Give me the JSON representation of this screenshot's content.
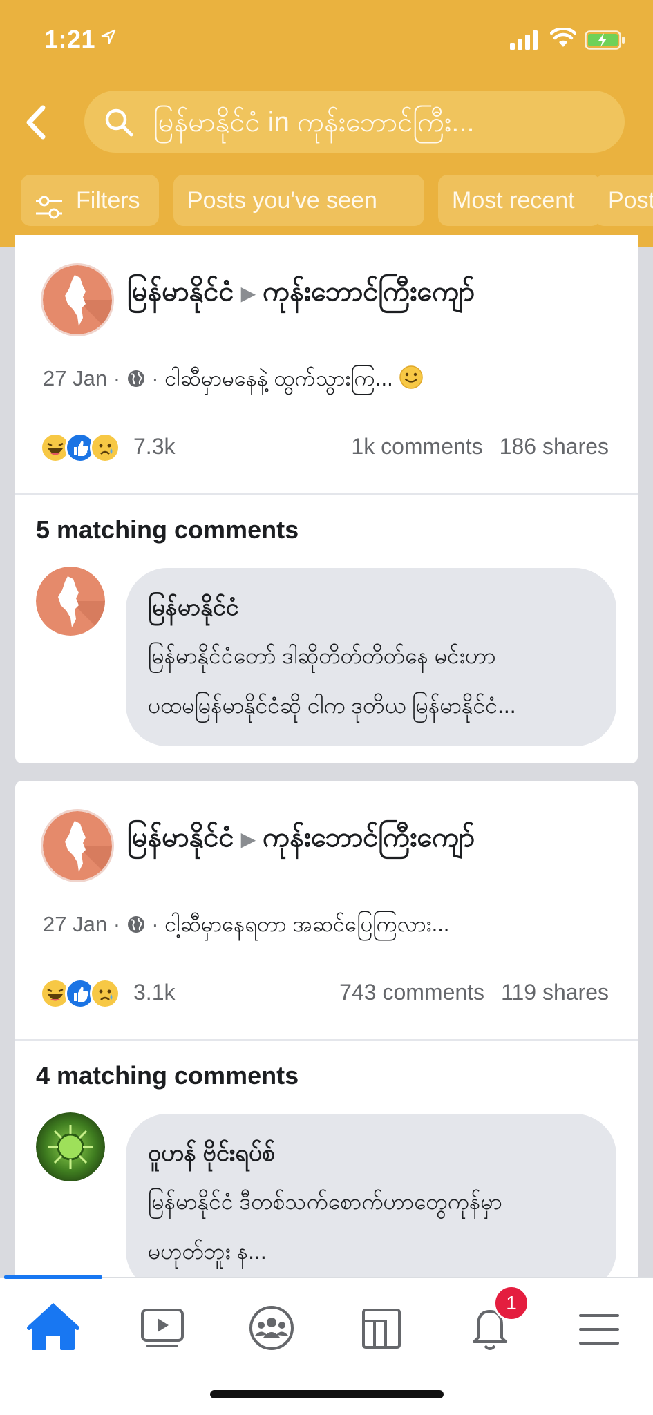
{
  "status_bar": {
    "time": "1:21"
  },
  "search": {
    "query": "မြန်မာနိုင်ငံ in ကုန်းဘောင်ကြီး..."
  },
  "filters": [
    {
      "label": "Filters"
    },
    {
      "label": "Posts you've seen"
    },
    {
      "label": "Most recent"
    },
    {
      "label": "Posts"
    }
  ],
  "posts": [
    {
      "page": "မြန်မာနိုင်ငံ",
      "group": "ကုန်းဘောင်ကြီးကျော်",
      "date": "27 Jan ·",
      "dot": "·",
      "text": "ငါဆီမှာမနေနဲ့ ထွက်သွားကြ...",
      "reactions": "7.3k",
      "comments": "1k comments",
      "shares": "186 shares",
      "matching": "5 matching comments",
      "comment": {
        "author": "မြန်မာနိုင်ငံ",
        "line1": "မြန်မာနိုင်ငံတော် ဒါဆိုတိတ်တိတ်နေ မင်းဟာ",
        "line2": "ပထမမြန်မာနိုင်ငံဆို ငါက ဒုတိယ မြန်မာနိုင်ငံ..."
      }
    },
    {
      "page": "မြန်မာနိုင်ငံ",
      "group": "ကုန်းဘောင်ကြီးကျော်",
      "date": "27 Jan ·",
      "dot": "·",
      "text": "ငါ့ဆီမှာနေရတာ အဆင်ပြေကြလား...",
      "reactions": "3.1k",
      "comments": "743 comments",
      "shares": "119 shares",
      "matching": "4 matching comments",
      "comment": {
        "author": "ဝူဟန် ဗိုင်းရပ်စ်",
        "line1": "မြန်မာနိုင်ငံ ဒီတစ်သက်စောက်ဟာတွေကုန်မှာ",
        "line2": "မဟုတ်ဘူး န..."
      }
    }
  ],
  "tabbar": {
    "notification_count": "1"
  },
  "colors": {
    "header": "#eab23f",
    "accent": "#1877f2",
    "badge": "#e41e3f"
  },
  "icons": [
    "back-chevron-icon",
    "search-icon",
    "filter-sliders-icon",
    "home-icon",
    "watch-icon",
    "groups-icon",
    "pages-icon",
    "bell-icon",
    "menu-icon",
    "globe-icon",
    "smile-emoji-icon"
  ]
}
